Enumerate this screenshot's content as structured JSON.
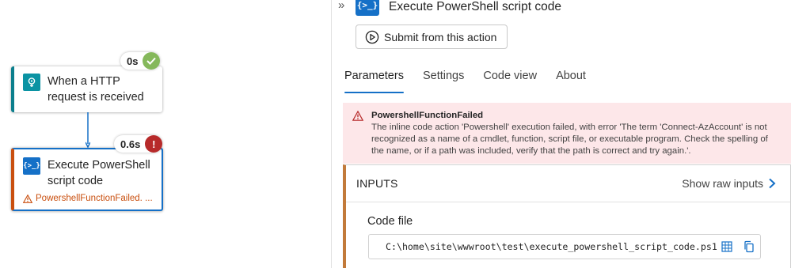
{
  "canvas": {
    "trigger": {
      "title": "When a HTTP request is received",
      "duration": "0s",
      "status": "succeeded"
    },
    "action": {
      "title": "Execute PowerShell script code",
      "duration": "0.6s",
      "status": "failed",
      "error_text": "PowershellFunctionFailed. ...",
      "status_icon": "!"
    }
  },
  "panel": {
    "title": "Execute PowerShell script code",
    "icon_glyph": "{>_}",
    "collapse_glyph": "»",
    "submit_label": "Submit from this action",
    "tabs": [
      {
        "label": "Parameters",
        "active": true
      },
      {
        "label": "Settings",
        "active": false
      },
      {
        "label": "Code view",
        "active": false
      },
      {
        "label": "About",
        "active": false
      }
    ],
    "error": {
      "title": "PowershellFunctionFailed",
      "message": "The inline code action 'Powershell' execution failed, with error 'The term 'Connect-AzAccount' is not recognized as a name of a cmdlet, function, script file, or executable program. Check the spelling of the name, or if a path was included, verify that the path is correct and try again.'."
    },
    "inputs": {
      "title": "INPUTS",
      "show_raw_label": "Show raw inputs",
      "code_file_label": "Code file",
      "code_file_value": "C:\\home\\site\\wwwroot\\test\\execute_powershell_script_code.ps1"
    }
  },
  "colors": {
    "accent": "#1570c7",
    "success": "#85b85b",
    "error": "#b72a2a",
    "error_text": "#c94f0f",
    "trigger_teal": "#0b93a3",
    "error_banner_bg": "#fde7e9"
  }
}
